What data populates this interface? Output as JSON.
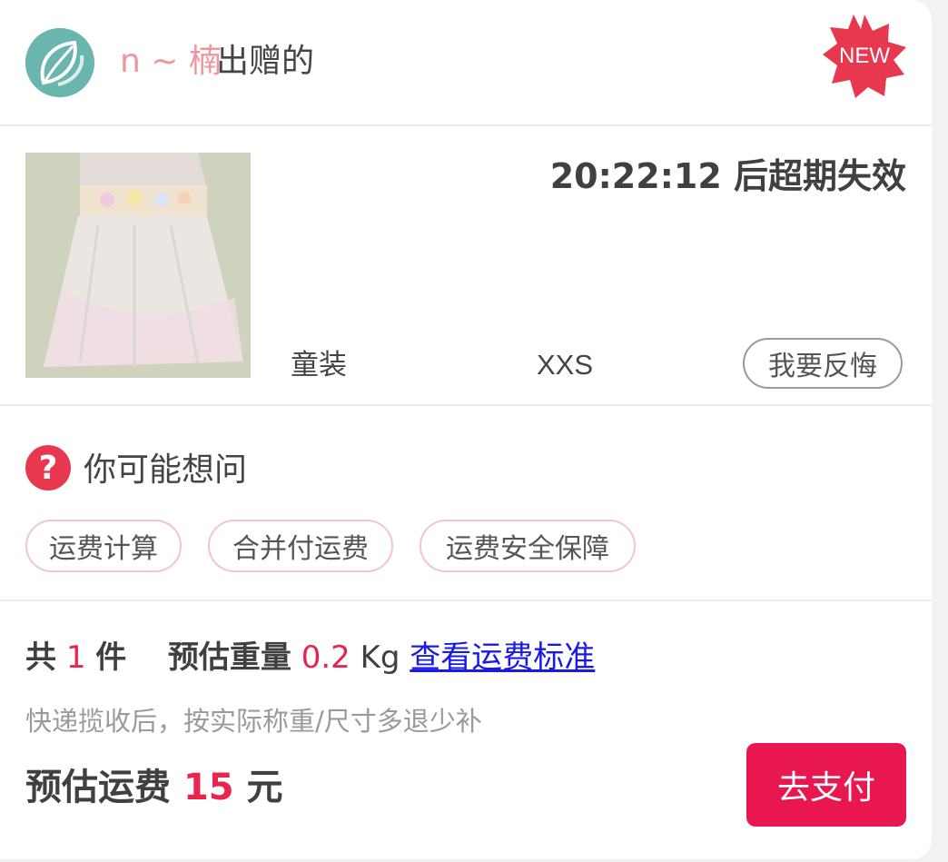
{
  "header": {
    "username": "n ~ 楠",
    "gift_text": "出赠的",
    "badge": "NEW"
  },
  "product": {
    "countdown": "20:22:12 后超期失效",
    "category": "童装",
    "size": "XXS",
    "regret_button": "我要反悔"
  },
  "faq": {
    "title": "你可能想问",
    "chips": [
      "运费计算",
      "合并付运费",
      "运费安全保障"
    ]
  },
  "shipping": {
    "total_prefix": "共",
    "count": "1",
    "count_unit": "件",
    "weight_label": "预估重量",
    "weight_value": "0.2",
    "weight_unit": "Kg",
    "standard_link": "查看运费标准",
    "note": "快递揽收后，按实际称重/尺寸多退少补",
    "fee_label": "预估运费",
    "fee_value": "15",
    "fee_unit": "元",
    "pay_button": "去支付"
  },
  "colors": {
    "accent": "#e8174f",
    "username": "#f0959b",
    "avatar_bg": "#6ab5ad"
  }
}
